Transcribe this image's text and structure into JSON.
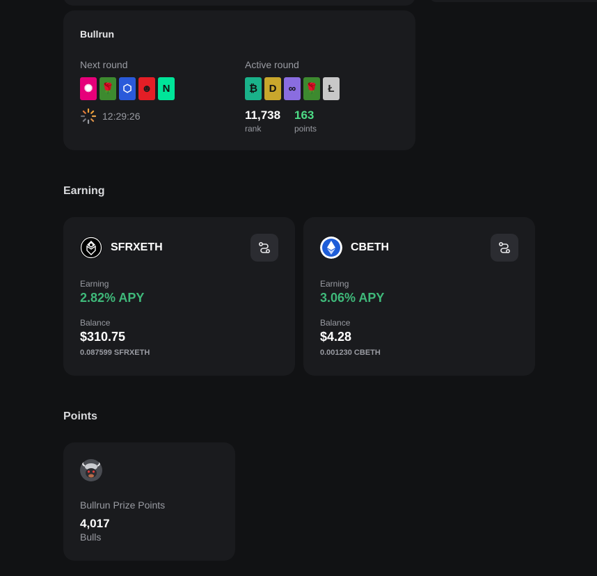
{
  "bullrun": {
    "title": "Bullrun",
    "next_round": {
      "label": "Next round",
      "tokens": [
        {
          "icon": "polkadot-icon",
          "glyph": "✺",
          "color": "#e6007a",
          "fg": "#ffffff"
        },
        {
          "icon": "rose-icon",
          "glyph": "🌹",
          "color": "#3d8a2f",
          "fg": "#ff3b3b"
        },
        {
          "icon": "chainlink-icon",
          "glyph": "⬡",
          "color": "#2a5ada",
          "fg": "#ffffff"
        },
        {
          "icon": "bull-face-icon",
          "glyph": "☻",
          "color": "#e41e26",
          "fg": "#1a1a1a"
        },
        {
          "icon": "near-icon",
          "glyph": "N",
          "color": "#00e599",
          "fg": "#111111"
        }
      ],
      "timer": "12:29:26"
    },
    "active_round": {
      "label": "Active round",
      "tokens": [
        {
          "icon": "bitcoin-icon",
          "glyph": "₿",
          "color": "#1ab28a",
          "fg": "#111111"
        },
        {
          "icon": "dogecoin-icon",
          "glyph": "D",
          "color": "#c9a72c",
          "fg": "#111111"
        },
        {
          "icon": "infinity-icon",
          "glyph": "∞",
          "color": "#8a6de0",
          "fg": "#111111"
        },
        {
          "icon": "rose-icon",
          "glyph": "🌹",
          "color": "#3d8a2f",
          "fg": "#ff3b3b"
        },
        {
          "icon": "litecoin-icon",
          "glyph": "Ł",
          "color": "#c8c8c8",
          "fg": "#222222"
        }
      ],
      "rank": "11,738",
      "rank_label": "rank",
      "points": "163",
      "points_label": "points",
      "points_color": "#4ddc86"
    }
  },
  "earning": {
    "section_title": "Earning",
    "cards": [
      {
        "token": "SFRXETH",
        "icon": "sfrxeth-icon",
        "earning_label": "Earning",
        "apy": "2.82% APY",
        "balance_label": "Balance",
        "balance": "$310.75",
        "amount": "0.087599 SFRXETH"
      },
      {
        "token": "CBETH",
        "icon": "cbeth-icon",
        "earning_label": "Earning",
        "apy": "3.06% APY",
        "balance_label": "Balance",
        "balance": "$4.28",
        "amount": "0.001230 CBETH"
      }
    ]
  },
  "points": {
    "section_title": "Points",
    "card": {
      "icon": "bull-avatar-icon",
      "title": "Bullrun Prize Points",
      "value": "4,017",
      "unit": "Bulls"
    }
  },
  "colors": {
    "background": "#111214",
    "card": "#1a1b1e",
    "apy_green": "#3fb97a",
    "muted": "#9a9ca3"
  }
}
